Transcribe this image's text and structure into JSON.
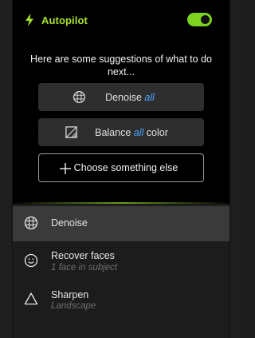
{
  "colors": {
    "accent_green": "#a6e22e",
    "toggle_green": "#7ed321",
    "accent_blue": "#4aa3ff"
  },
  "header": {
    "icon": "lightning-bolt-icon",
    "title": "Autopilot",
    "toggle_on": true
  },
  "prompt": "Here are some suggestions of what to do next...",
  "suggestions": [
    {
      "icon": "denoise-grid-icon",
      "label": "Denoise",
      "accent": "all",
      "suffix": ""
    },
    {
      "icon": "balance-square-icon",
      "label": "Balance",
      "accent": "all",
      "suffix": "color"
    },
    {
      "icon": "plus-icon",
      "label": "Choose something else"
    }
  ],
  "list": [
    {
      "icon": "denoise-grid-icon",
      "label": "Denoise",
      "sub": "",
      "active": true
    },
    {
      "icon": "smiley-face-icon",
      "label": "Recover faces",
      "sub": "1 face in subject",
      "active": false
    },
    {
      "icon": "triangle-icon",
      "label": "Sharpen",
      "sub": "Landscape",
      "active": false
    }
  ]
}
